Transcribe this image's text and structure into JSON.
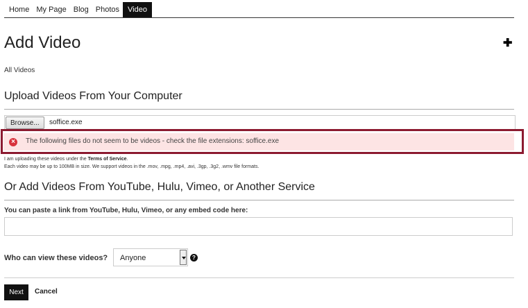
{
  "nav": {
    "items": [
      "Home",
      "My Page",
      "Blog",
      "Photos",
      "Video"
    ],
    "active": "Video"
  },
  "page": {
    "title": "Add Video",
    "all_videos_link": "All Videos",
    "add_icon": "plus-icon"
  },
  "upload": {
    "heading": "Upload Videos From Your Computer",
    "browse_label": "Browse...",
    "file_name": "soffice.exe",
    "error_icon": "error-x-icon",
    "error_message": "The following files do not seem to be videos - check the file extensions: soffice.exe",
    "terms_prefix": "I am uploading these videos under the ",
    "terms_link": "Terms of Service",
    "terms_suffix": ".",
    "size_note": "Each video may be up to 100MB in size. We support videos in the .mov, .mpg, .mp4, .avi, .3gp, .3g2, .wmv file formats."
  },
  "embed": {
    "heading": "Or Add Videos From YouTube, Hulu, Vimeo, or Another Service",
    "label": "You can paste a link from YouTube, Hulu, Vimeo, or any embed code here:",
    "value": ""
  },
  "privacy": {
    "label": "Who can view these videos?",
    "selected": "Anyone",
    "help_icon": "question-icon"
  },
  "actions": {
    "next_label": "Next",
    "cancel_label": "Cancel"
  },
  "colors": {
    "error_outline": "#8c1a30",
    "error_bg": "#fde4e4",
    "error_icon": "#d8323c",
    "dark": "#111111"
  }
}
